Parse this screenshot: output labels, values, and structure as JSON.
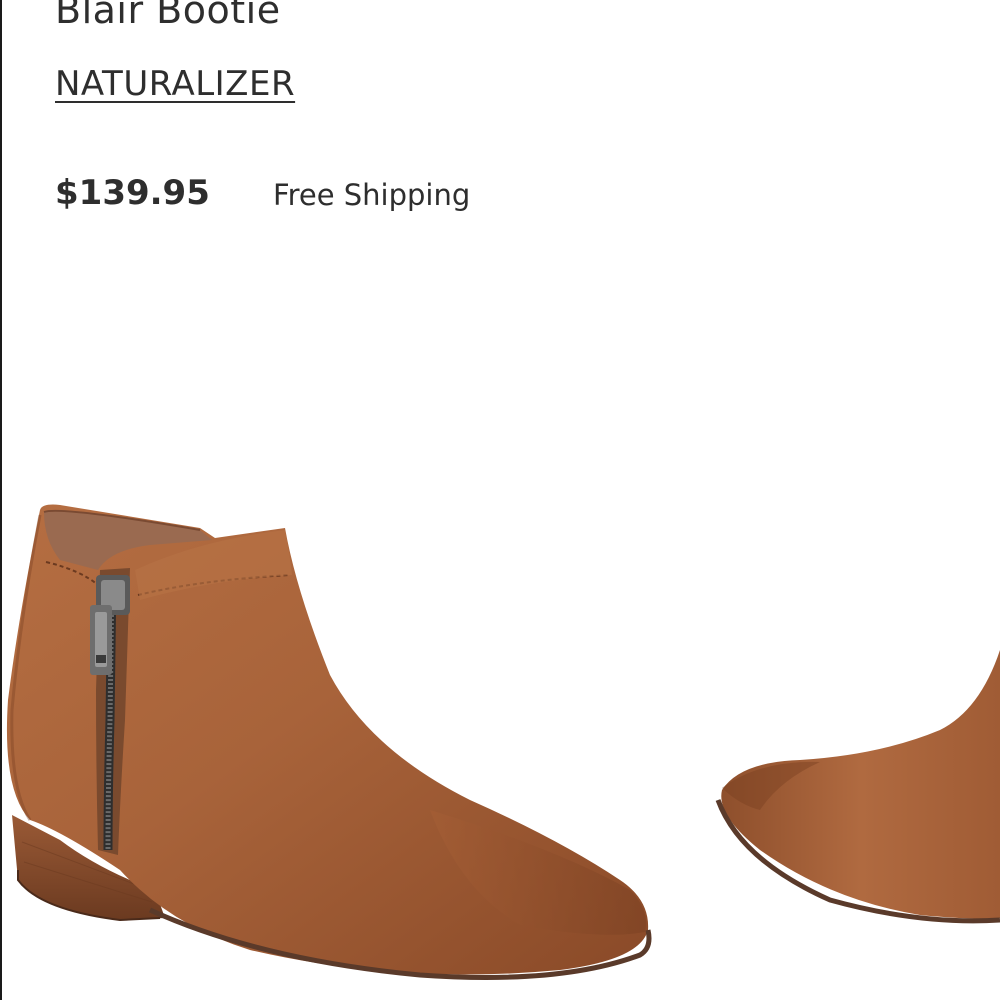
{
  "product": {
    "title": "Blair Bootie",
    "brand": "NATURALIZER",
    "price": "$139.95",
    "shipping": "Free Shipping"
  },
  "image": {
    "subject": "ankle-boot-photo",
    "colors": {
      "leather": "#a8633a",
      "leather_light": "#c07a4a",
      "leather_dark": "#7a4022",
      "lining": "#9a6a50",
      "zipper": "#3a3a3a",
      "pull": "#6e6e6e",
      "sole": "#5a3a2a"
    }
  }
}
